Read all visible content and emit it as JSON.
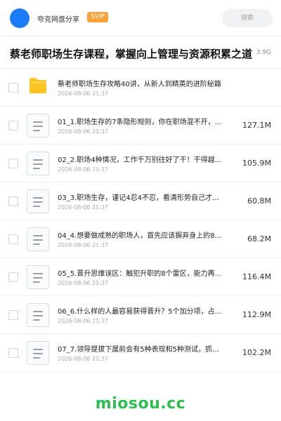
{
  "header": {
    "share_name": "夸克网盘分享",
    "badge": "SVIP",
    "search_placeholder": "搜索",
    "avatar_color": "#1a7cf5",
    "badge_color": "#f7a33a"
  },
  "folder": {
    "title": "蔡老师职场生存课程，掌握向上管理与资源积累之道",
    "total_size": "3.9G"
  },
  "files": [
    {
      "type": "folder",
      "name": "蔡老师职场生存攻略40讲，从新人到精英的进阶秘籍",
      "date": "2026-08-06 21:37",
      "size": ""
    },
    {
      "type": "doc",
      "name": "01_1.职场生存的7条隐形规则，你在职场混不开，…",
      "date": "2026-08-06 21:37",
      "size": "127.1M"
    },
    {
      "type": "doc",
      "name": "02_2.职场4种情况，工作千万别往好了干！干得越…",
      "date": "2026-08-06 21:37",
      "size": "105.9M"
    },
    {
      "type": "doc",
      "name": "03_3.职场生存，谨记4忍4不忍，看清形势自己才…",
      "date": "2026-08-06 21:37",
      "size": "60.8M"
    },
    {
      "type": "doc",
      "name": "04_4.想要做成熟的职场人，首先应该摒弃身上的8…",
      "date": "2026-08-06 21:37",
      "size": "68.2M"
    },
    {
      "type": "doc",
      "name": "05_5.晋升思维误区：触犯升职的8个雷区，能力再…",
      "date": "2026-08-06 21:37",
      "size": "116.4M"
    },
    {
      "type": "doc",
      "name": "06_6.什么样的人最容易获得晋升？5个加分项，占…",
      "date": "2026-08-06 21:37",
      "size": "112.9M"
    },
    {
      "type": "doc",
      "name": "07_7.领导提拔下属前会有5种表现和5种测试，抓…",
      "date": "2026-08-06 21:37",
      "size": "102.2M"
    }
  ],
  "watermark": "miosou.cc",
  "watermark_color": "#2dbe4f",
  "folder_icon_color": "#ffc31f"
}
